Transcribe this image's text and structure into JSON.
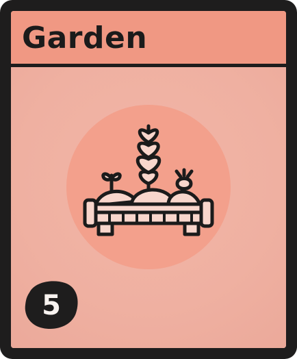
{
  "card": {
    "title": "Garden",
    "cost": "5",
    "illustration_icon": "garden-planter-icon",
    "badge_icon": "cost-blob-icon",
    "colors": {
      "frame": "#1e1d1d",
      "title_bar": "#f09883",
      "body": "#efb0a1",
      "circle": "#f3a08c",
      "ink": "#1b1b1b",
      "accent_light": "#f8d6cc"
    }
  }
}
